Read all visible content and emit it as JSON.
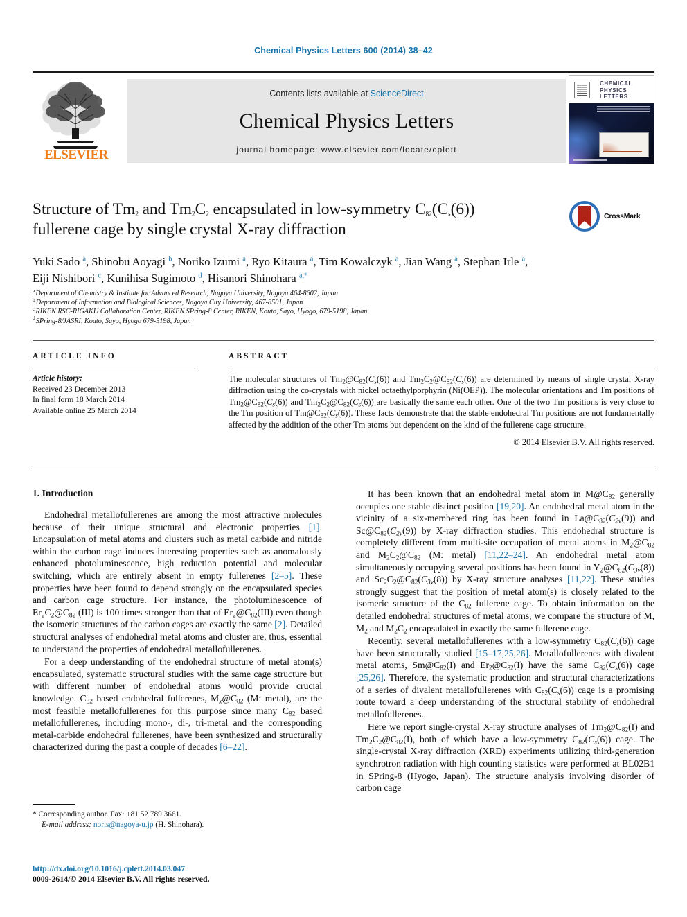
{
  "running_head": "Chemical Physics Letters 600 (2014) 38–42",
  "masthead": {
    "publisher_name": "ELSEVIER",
    "contents_prefix": "Contents lists available at ",
    "contents_link": "ScienceDirect",
    "journal_name": "Chemical Physics Letters",
    "homepage": "journal homepage: www.elsevier.com/locate/cplett",
    "cover_title": "CHEMICAL PHYSICS LETTERS"
  },
  "title": {
    "line1_pre": "Structure of Tm",
    "line1_sub1": "2",
    "line1_mid": " and Tm",
    "line1_sub2": "2",
    "line1_mid2": "C",
    "line1_sub3": "2",
    "line1_mid3": " encapsulated in low-symmetry C",
    "line1_sub4": "82",
    "line1_mid4": "(C",
    "line1_sub5": "s",
    "line1_end": "(6))",
    "line2": "fullerene cage by single crystal X-ray diffraction"
  },
  "crossmark": {
    "label": "CrossMark",
    "ring_color": "#2a6fb8",
    "ribbon_color": "#b02418"
  },
  "authors": {
    "list": [
      {
        "name": "Yuki Sado",
        "marks": "a",
        "sep": ", "
      },
      {
        "name": "Shinobu Aoyagi",
        "marks": "b",
        "sep": ", "
      },
      {
        "name": "Noriko Izumi",
        "marks": "a",
        "sep": ", "
      },
      {
        "name": "Ryo Kitaura",
        "marks": "a",
        "sep": ", "
      },
      {
        "name": "Tim Kowalczyk",
        "marks": "a",
        "sep": ", "
      },
      {
        "name": "Jian Wang",
        "marks": "a",
        "sep": ", "
      },
      {
        "name": "Stephan Irle",
        "marks": "a",
        "sep": ", "
      },
      {
        "name": "Eiji Nishibori",
        "marks": "c",
        "sep": ", "
      },
      {
        "name": "Kunihisa Sugimoto",
        "marks": "d",
        "sep": ", "
      },
      {
        "name": "Hisanori Shinohara",
        "marks": "a,*",
        "sep": ""
      }
    ]
  },
  "affiliations": [
    {
      "mark": "a",
      "text": "Department of Chemistry & Institute for Advanced Research, Nagoya University, Nagoya 464-8602, Japan"
    },
    {
      "mark": "b",
      "text": "Department of Information and Biological Sciences, Nagoya City University, 467-8501, Japan"
    },
    {
      "mark": "c",
      "text": "RIKEN RSC-RIGAKU Collaboration Center, RIKEN SPring-8 Center, RIKEN, Kouto, Sayo, Hyogo, 679-5198, Japan"
    },
    {
      "mark": "d",
      "text": "SPring-8/JASRI, Kouto, Sayo, Hyogo 679-5198, Japan"
    }
  ],
  "article_info": {
    "heading": "ARTICLE INFO",
    "history_label": "Article history:",
    "received": "Received 23 December 2013",
    "final_form": "In final form 18 March 2014",
    "available": "Available online 25 March 2014"
  },
  "abstract": {
    "heading": "ABSTRACT",
    "copyright": "© 2014 Elsevier B.V. All rights reserved."
  },
  "sections": {
    "introduction_heading": "1. Introduction"
  },
  "footnote": {
    "corresponding": "* Corresponding author. Fax: +81 52 789 3661.",
    "email_label": "E-mail address:",
    "email": "noris@nagoya-u.jp",
    "email_suffix": "(H. Shinohara)."
  },
  "publisher_footer": {
    "doi": "http://dx.doi.org/10.1016/j.cplett.2014.03.047",
    "issn_line": "0009-2614/© 2014 Elsevier B.V. All rights reserved."
  },
  "colors": {
    "link_blue": "#1b74a8",
    "elsevier_orange": "#f07d1a",
    "banner_gray": "#e6e6e6"
  }
}
